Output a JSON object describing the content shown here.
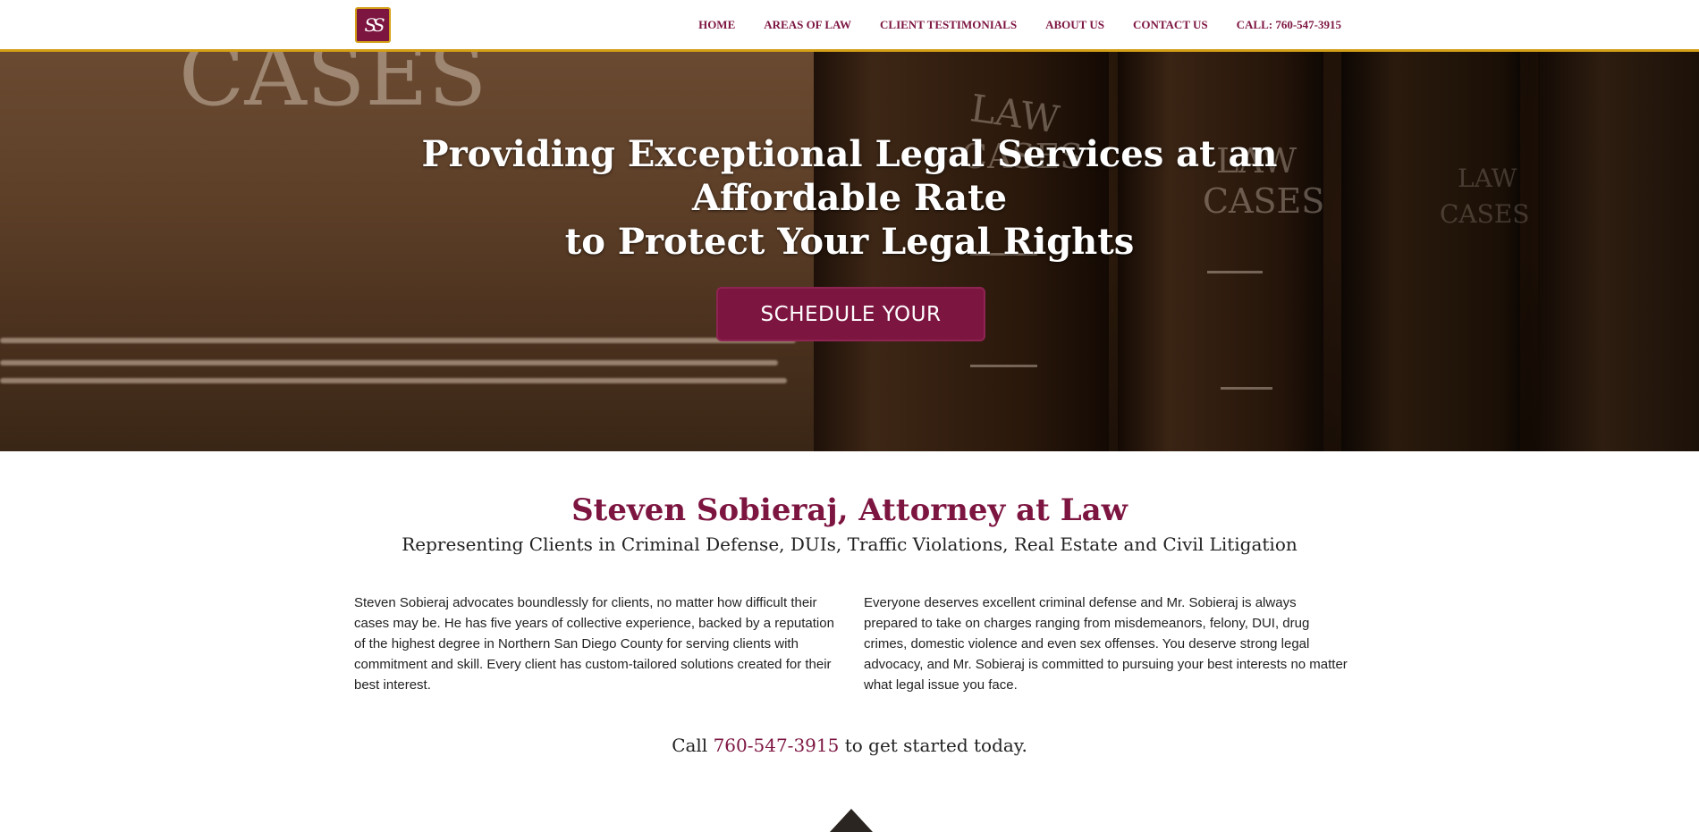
{
  "header": {
    "logo_text": "SS",
    "nav": [
      {
        "label": "HOME"
      },
      {
        "label": "AREAS OF LAW"
      },
      {
        "label": "CLIENT TESTIMONIALS"
      },
      {
        "label": "ABOUT US"
      },
      {
        "label": "CONTACT US"
      },
      {
        "label": "CALL: 760-547-3915"
      }
    ]
  },
  "hero": {
    "title_line1": "Providing Exceptional Legal Services at an Affordable Rate",
    "title_line2": "to Protect Your Legal Rights",
    "cta_label": "SCHEDULE YOUR",
    "background_words": [
      "CASES",
      "LAW",
      "CASES",
      "LAW",
      "CASES",
      "LAW",
      "CASES"
    ]
  },
  "intro": {
    "title": "Steven Sobieraj, Attorney at Law",
    "subtitle": "Representing Clients in Criminal Defense, DUIs, Traffic Violations, Real Estate and Civil Litigation",
    "col_left": "Steven Sobieraj advocates boundlessly for clients, no matter how difficult their cases may be. He has five years of collective experience, backed by a reputation of the highest degree in Northern San Diego County for serving clients with commitment and skill. Every client has custom-tailored solutions created for their best interest.",
    "col_right": "Everyone deserves excellent criminal defense and Mr. Sobieraj is always prepared to take on charges ranging from misdemeanors, felony, DUI, drug crimes, domestic violence and even sex offenses. You deserve strong legal advocacy, and Mr. Sobieraj is committed to pursuing your best interests no matter what legal issue you face.",
    "call_prefix": "Call",
    "call_phone": "760-547-3915",
    "call_suffix": "to get started today."
  },
  "colors": {
    "brand": "#7d1541",
    "accent": "#d4a017"
  }
}
